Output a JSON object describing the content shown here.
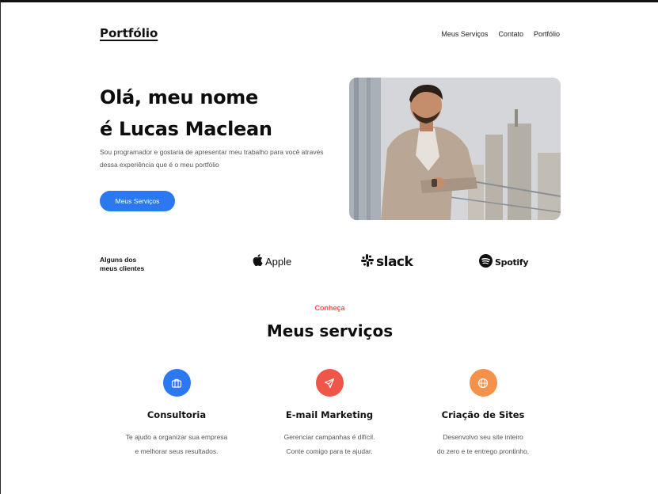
{
  "header": {
    "logo": "Portfólio",
    "nav": [
      "Meus Serviços",
      "Contato",
      "Portfólio"
    ]
  },
  "hero": {
    "title_line1": "Olá, meu nome",
    "title_line2": "é Lucas Maclean",
    "description": "Sou programador e gostaria de apresentar meu trabalho para você através dessa experiência que é o meu portfólio",
    "button": "Meus Serviços"
  },
  "clients": {
    "label_line1": "Alguns dos",
    "label_line2": "meus clientes",
    "logos": [
      {
        "name": "Apple",
        "icon": "apple-icon"
      },
      {
        "name": "slack",
        "icon": "slack-icon"
      },
      {
        "name": "Spotify",
        "icon": "spotify-icon"
      }
    ]
  },
  "services": {
    "eyebrow": "Conheça",
    "title": "Meus serviços",
    "items": [
      {
        "icon": "briefcase-icon",
        "color": "#2b78f0",
        "title": "Consultoria",
        "desc_line1": "Te ajudo a organizar sua empresa",
        "desc_line2": "e melhorar seus resultados."
      },
      {
        "icon": "send-icon",
        "color": "#f0554a",
        "title": "E-mail Marketing",
        "desc_line1": "Gerenciar campanhas é difícil.",
        "desc_line2": "Conte comigo para te ajudar."
      },
      {
        "icon": "globe-icon",
        "color": "#f5914a",
        "title": "Criação de Sites",
        "desc_line1": "Desenvolvo seu site inteiro",
        "desc_line2": "do zero e te entrego prontinho."
      }
    ]
  },
  "colors": {
    "primary": "#2b78f0",
    "accent": "#f0554a",
    "orange": "#f5914a"
  }
}
